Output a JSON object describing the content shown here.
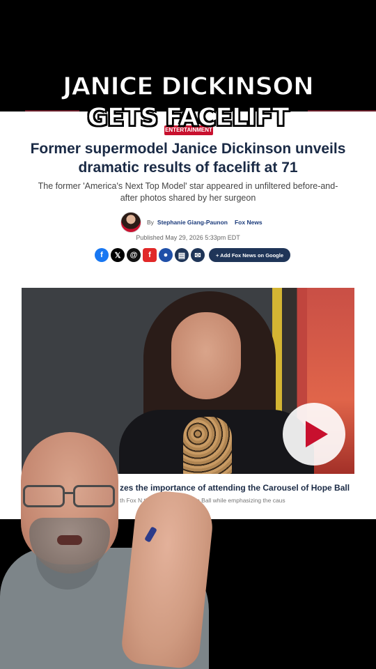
{
  "overlay": {
    "line1": "JANICE DICKINSON",
    "line2": "GETS FACELIFT"
  },
  "article": {
    "category": "ENTERTAINMENT",
    "headline": "Former supermodel Janice Dickinson unveils dramatic results of facelift at 71",
    "subhead": "The former 'America's Next Top Model' star appeared in unfiltered before-and-after photos shared by her surgeon",
    "byline_prefix": "By",
    "author": "Stephanie Giang-Paunon",
    "outlet": "Fox News",
    "published": "Published May 29, 2026 5:33pm EDT",
    "share_buttons": [
      {
        "icon": "facebook-icon",
        "glyph": "f"
      },
      {
        "icon": "x-icon",
        "glyph": "𝕏"
      },
      {
        "icon": "threads-icon",
        "glyph": "@"
      },
      {
        "icon": "flipboard-icon",
        "glyph": "f"
      },
      {
        "icon": "comment-icon",
        "glyph": "●"
      },
      {
        "icon": "print-icon",
        "glyph": "▤"
      },
      {
        "icon": "email-icon",
        "glyph": "✉"
      }
    ],
    "add_google_label": "+ Add Fox News on Google",
    "video_caption": "zes the importance of attending the Carousel of Hope Ball",
    "video_subcaption": "th Fox N    the Carousel of Hope Ball while emphasizing the caus"
  },
  "colors": {
    "brand_red": "#c8102e",
    "headline_navy": "#1a2a45",
    "button_navy": "#1f3558"
  }
}
